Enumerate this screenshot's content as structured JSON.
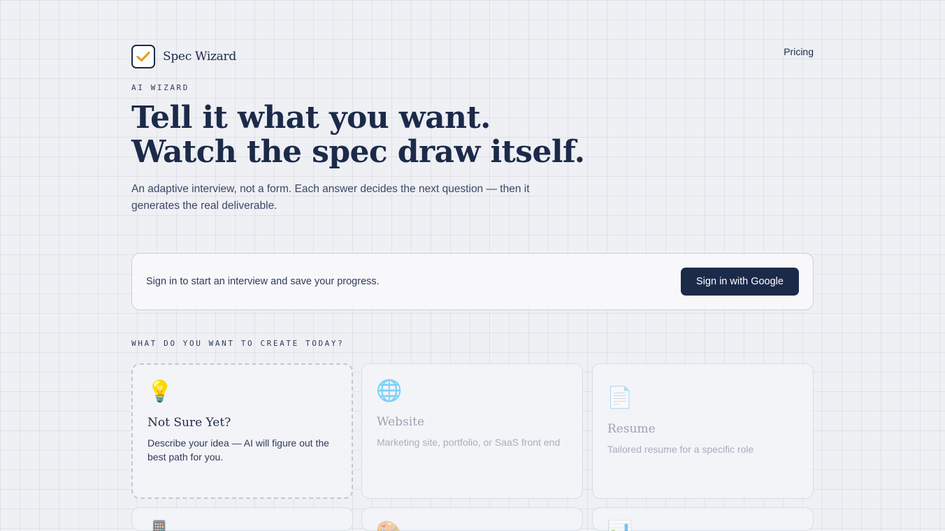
{
  "brand": {
    "name": "Spec Wizard",
    "icon": "checkbox-check-icon",
    "accent_check": "#e0a030"
  },
  "nav": {
    "pricing": "Pricing"
  },
  "hero": {
    "eyebrow": "AI WIZARD",
    "title_line1": "Tell it what you want.",
    "title_line2": "Watch the spec draw itself.",
    "subtitle": "An adaptive interview, not a form. Each answer decides the next question — then it generates the real deliverable."
  },
  "signin": {
    "message": "Sign in to start an interview and save your progress.",
    "button": "Sign in with Google"
  },
  "create": {
    "label": "WHAT DO YOU WANT TO CREATE TODAY?",
    "cards": [
      {
        "icon": "💡",
        "icon_name": "lightbulb-icon",
        "title": "Not Sure Yet?",
        "desc": "Describe your idea — AI will figure out the best path for you."
      },
      {
        "icon": "🌐",
        "icon_name": "globe-icon",
        "title": "Website",
        "desc": "Marketing site, portfolio, or SaaS front end"
      },
      {
        "icon": "📄",
        "icon_name": "document-icon",
        "title": "Resume",
        "desc": "Tailored resume for a specific role"
      },
      {
        "icon": "📱",
        "icon_name": "phone-icon"
      },
      {
        "icon": "🎨",
        "icon_name": "palette-icon"
      },
      {
        "icon": "📊",
        "icon_name": "chart-icon"
      }
    ]
  },
  "colors": {
    "primary": "#1c2a4a",
    "background": "#eef0f4"
  }
}
